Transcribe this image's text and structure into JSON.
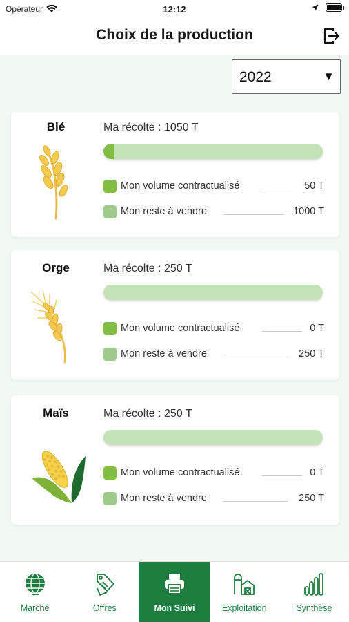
{
  "status_bar": {
    "carrier": "Opérateur",
    "time": "12:12"
  },
  "header": {
    "title": "Choix de la production",
    "logout_icon": "logout-icon"
  },
  "year_selector": {
    "selected": "2022",
    "arrow": "▼"
  },
  "crops": [
    {
      "name": "Blé",
      "icon": "wheat-icon",
      "harvest": "Ma récolte : 1050 T",
      "contract_fraction": 0.048,
      "contract_label": "Mon volume contractualisé",
      "contract_value": "50 T",
      "rest_label": "Mon reste à vendre",
      "rest_value": "1000 T"
    },
    {
      "name": "Orge",
      "icon": "barley-icon",
      "harvest": "Ma récolte : 250 T",
      "contract_fraction": 0,
      "contract_label": "Mon volume contractualisé",
      "contract_value": "0 T",
      "rest_label": "Mon reste à vendre",
      "rest_value": "250 T"
    },
    {
      "name": "Maïs",
      "icon": "corn-icon",
      "harvest": "Ma récolte : 250 T",
      "contract_fraction": 0,
      "contract_label": "Mon volume contractualisé",
      "contract_value": "0 T",
      "rest_label": "Mon reste à vendre",
      "rest_value": "250 T"
    }
  ],
  "tabs": [
    {
      "label": "Marché",
      "icon": "globe-icon",
      "active": false
    },
    {
      "label": "Offres",
      "icon": "price-tag-icon",
      "active": false
    },
    {
      "label": "Mon Suivi",
      "icon": "printer-icon",
      "active": true
    },
    {
      "label": "Exploitation",
      "icon": "farm-icon",
      "active": false
    },
    {
      "label": "Synthèse",
      "icon": "bar-chart-icon",
      "active": false
    }
  ],
  "colors": {
    "brand_green": "#1c7d3e",
    "contract_green": "#82be46",
    "rest_green": "#c3e3b6",
    "background": "#f2f8f4"
  }
}
